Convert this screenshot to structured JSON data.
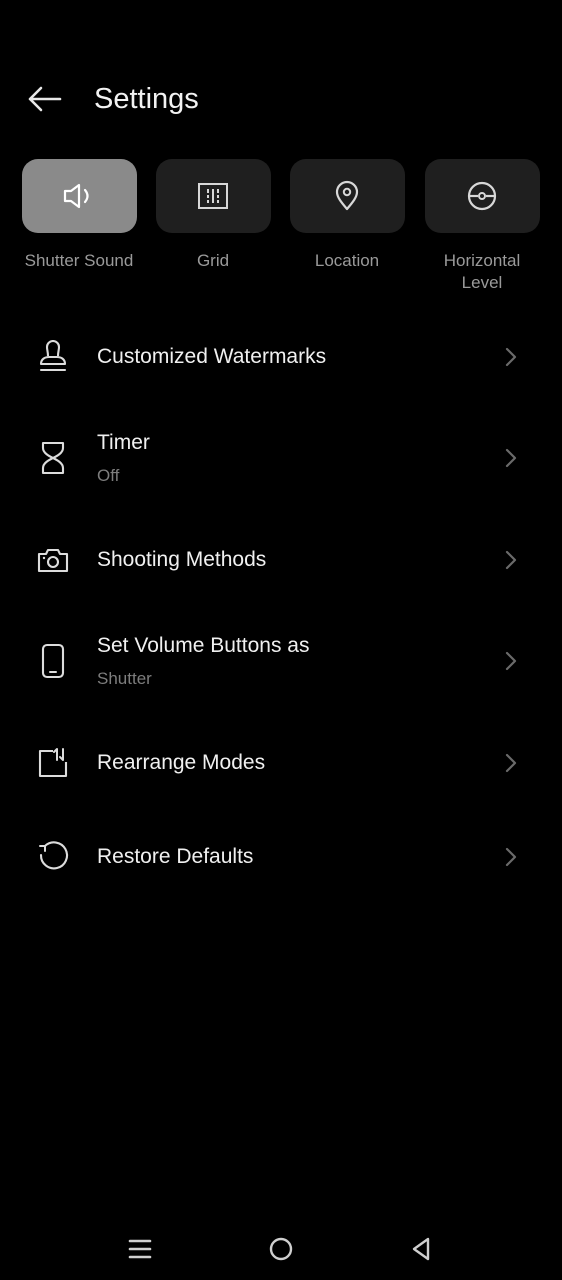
{
  "header": {
    "title": "Settings"
  },
  "toggles": [
    {
      "label": "Shutter Sound",
      "icon": "speaker-icon",
      "active": true
    },
    {
      "label": "Grid",
      "icon": "grid-icon",
      "active": false
    },
    {
      "label": "Location",
      "icon": "location-pin-icon",
      "active": false
    },
    {
      "label": "Horizontal\nLevel",
      "icon": "level-icon",
      "active": false
    }
  ],
  "menu": [
    {
      "title": "Customized Watermarks",
      "subtitle": "",
      "icon": "stamp-icon"
    },
    {
      "title": "Timer",
      "subtitle": "Off",
      "icon": "hourglass-icon"
    },
    {
      "title": "Shooting Methods",
      "subtitle": "",
      "icon": "camera-icon"
    },
    {
      "title": "Set Volume Buttons as",
      "subtitle": "Shutter",
      "icon": "phone-icon"
    },
    {
      "title": "Rearrange Modes",
      "subtitle": "",
      "icon": "rearrange-icon"
    },
    {
      "title": "Restore Defaults",
      "subtitle": "",
      "icon": "restore-icon"
    }
  ],
  "colors": {
    "background": "#000000",
    "tile": "#1f1f1f",
    "tile_active": "#8a8a8a",
    "label_muted": "#9a9a9a",
    "subtitle": "#7d7d7d"
  },
  "navbar": {
    "icons": [
      "menu-icon",
      "home-icon",
      "back-triangle-icon"
    ]
  }
}
